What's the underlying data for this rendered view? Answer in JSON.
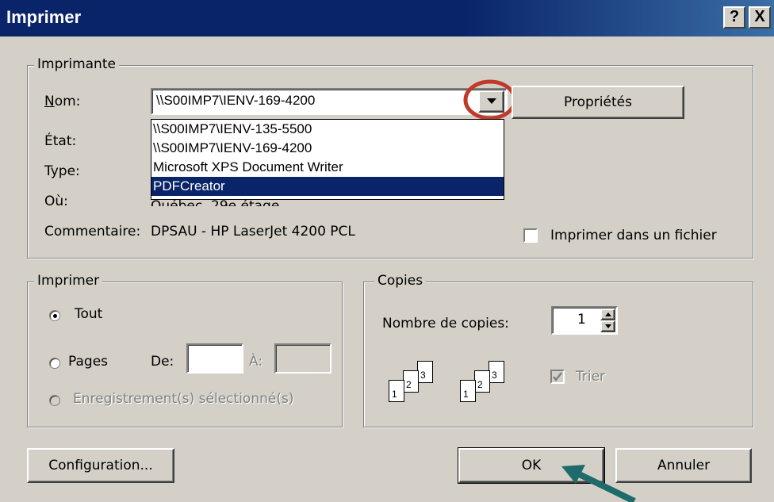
{
  "window": {
    "title": "Imprimer",
    "help_label": "?",
    "close_label": "X"
  },
  "printer_group": {
    "legend": "Imprimante",
    "name_label": "Nom:",
    "name_value": "\\\\S00IMP7\\IENV-169-4200",
    "properties_label": "Propriétés",
    "state_label": "État:",
    "type_label": "Type:",
    "where_label": "Où:",
    "where_value": "Québec, 29e étage",
    "comment_label": "Commentaire:",
    "comment_value": "DPSAU - HP LaserJet 4200 PCL",
    "print_to_file_label": "Imprimer dans un fichier",
    "dropdown_options": [
      "\\\\S00IMP7\\IENV-135-5500",
      "\\\\S00IMP7\\IENV-169-4200",
      "Microsoft XPS Document Writer",
      "PDFCreator"
    ],
    "selected_option": "PDFCreator"
  },
  "print_range": {
    "legend": "Imprimer",
    "all_label": "Tout",
    "pages_label": "Pages",
    "from_label": "De:",
    "to_label": "À:",
    "selection_label": "Enregistrement(s) sélectionné(s)"
  },
  "copies": {
    "legend": "Copies",
    "count_label": "Nombre de copies:",
    "count_value": "1",
    "collate_label": "Trier",
    "collate_checked": true,
    "page_numbers": [
      "1",
      "2",
      "3"
    ]
  },
  "buttons": {
    "setup": "Configuration...",
    "ok": "OK",
    "cancel": "Annuler"
  },
  "annotation_colors": {
    "circle": "#c0392b",
    "arrow": "#1f6b6b"
  }
}
